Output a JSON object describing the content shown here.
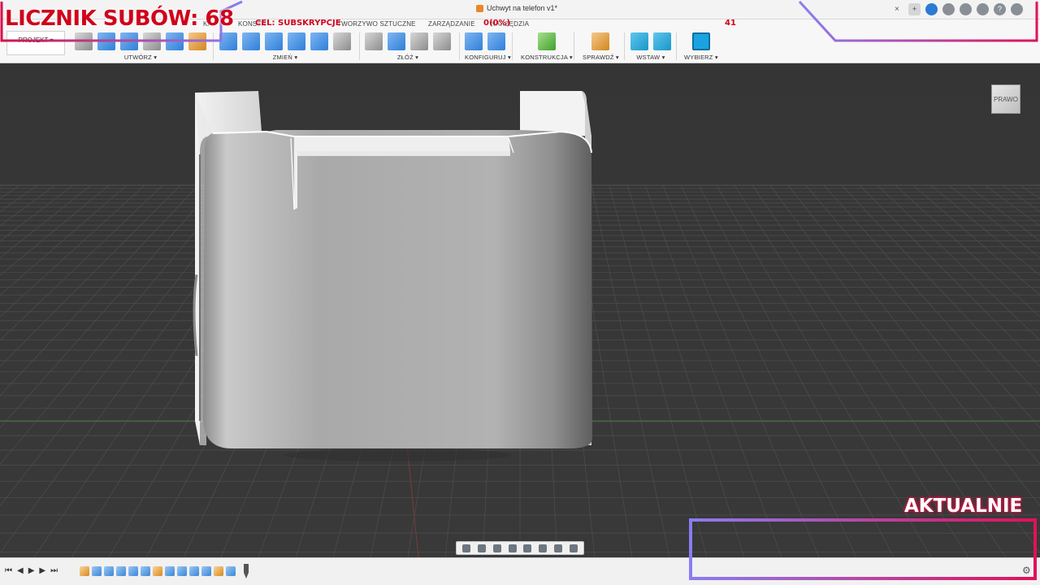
{
  "window": {
    "doc_title": "Uchwyt na telefon v1*",
    "close": "×"
  },
  "toolbar": {
    "projekt": "PROJEKT ▾"
  },
  "ribbon_tabs": [
    "KONSTR",
    "TWORZYWO SZTUCZNE",
    "ZARZĄDZANIE",
    "NARZĘDZIA",
    "KA"
  ],
  "groups": {
    "utworz": "UTWÓRZ ▾",
    "zmien": "ZMIEŃ ▾",
    "zloz": "ZŁÓŻ ▾",
    "konfiguruj": "KONFIGURUJ ▾",
    "konstrukcja": "KONSTRUKCJA ▾",
    "sprawdz": "SPRAWDŹ ▾",
    "wstaw": "WSTAW ▾",
    "wybierz": "WYBIERZ ▾"
  },
  "viewcube": {
    "label": "PRAWO"
  },
  "overlay": {
    "subs_counter": "LICZNIK SUBÓW: 68",
    "goal_label": "CEL: SUBSKRYPCJE",
    "goal_percent": "0(0%)",
    "goal_target": "41",
    "aktualnie": "AKTUALNIE"
  },
  "colors": {
    "accent": "#d8114a",
    "overlay_text": "#d0021b",
    "frame_gradient_end": "#8a7df0"
  }
}
